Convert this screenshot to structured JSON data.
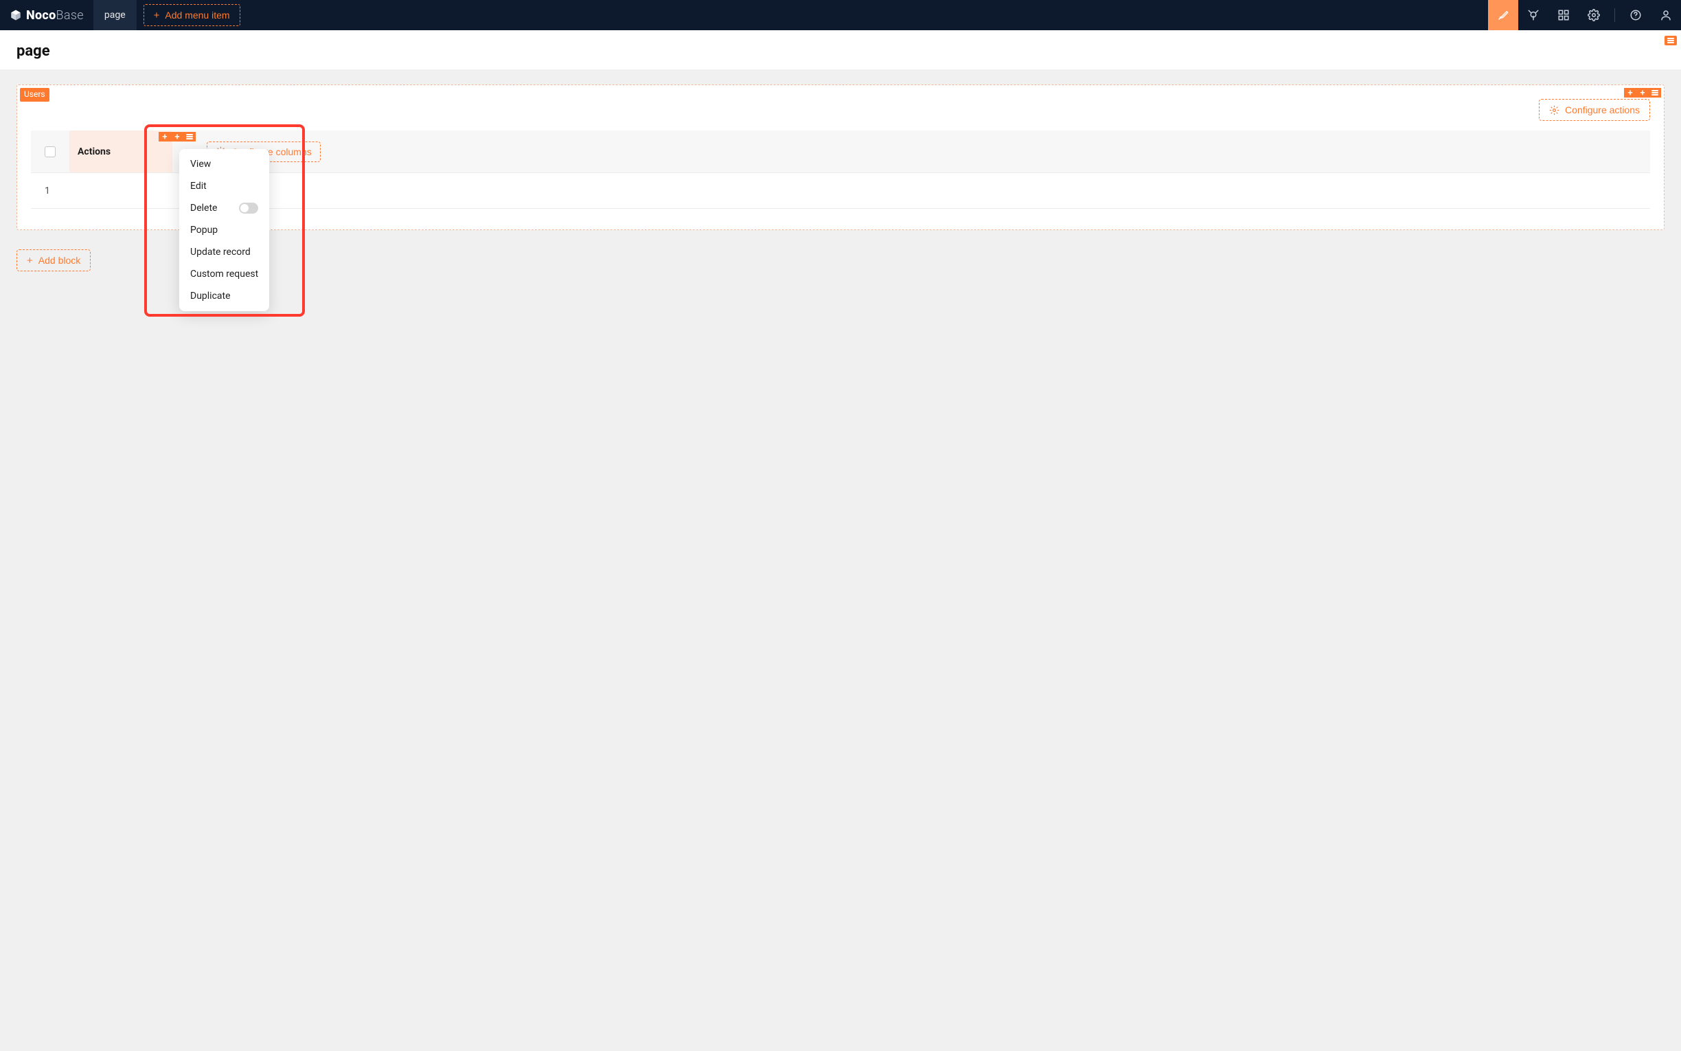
{
  "brand": {
    "part1": "Noco",
    "part2": "Base"
  },
  "nav": {
    "tab": "page",
    "add_menu_item": "Add menu item"
  },
  "page": {
    "title": "page"
  },
  "block": {
    "badge": "Users",
    "configure_actions": "Configure actions",
    "configure_columns": "Configure columns",
    "columns": {
      "actions": "Actions"
    },
    "rows": [
      {
        "index": "1"
      }
    ]
  },
  "add_block": "Add block",
  "dropdown": {
    "items": [
      {
        "label": "View",
        "toggle": false
      },
      {
        "label": "Edit",
        "toggle": false
      },
      {
        "label": "Delete",
        "toggle": true
      },
      {
        "label": "Popup",
        "toggle": false
      },
      {
        "label": "Update record",
        "toggle": false
      },
      {
        "label": "Custom request",
        "toggle": false
      },
      {
        "label": "Duplicate",
        "toggle": false
      }
    ]
  }
}
